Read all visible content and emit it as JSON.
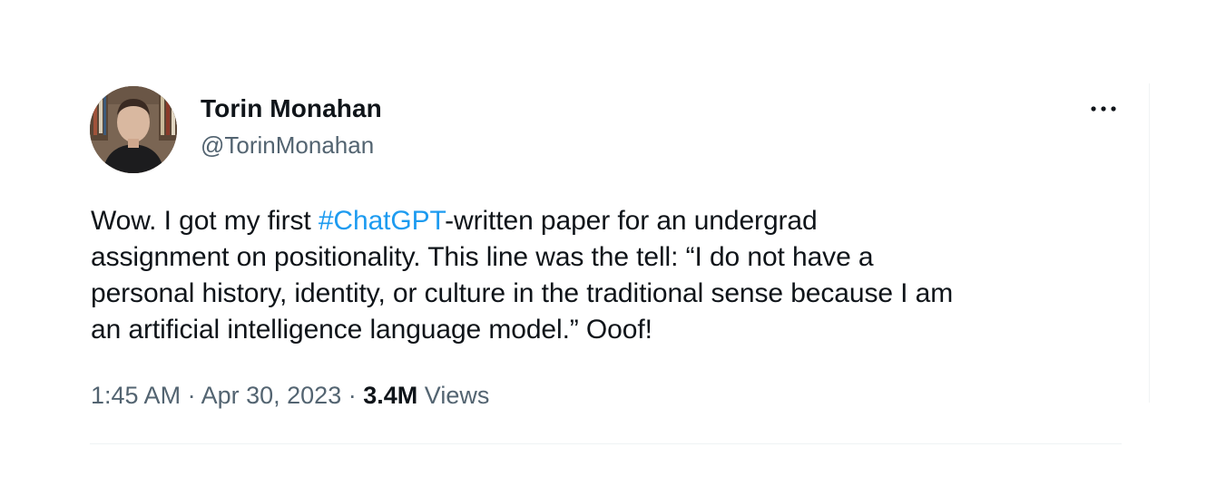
{
  "author": {
    "name": "Torin Monahan",
    "handle": "@TorinMonahan"
  },
  "more_icon": "more-horizontal-icon",
  "tweet": {
    "lines": [
      {
        "before": "Wow. I got my first ",
        "hashtag": "#ChatGPT",
        "after": "-written paper for an undergrad"
      },
      {
        "text": "assignment on positionality. This line was the tell: “I do not have a"
      },
      {
        "text": "personal history, identity, or culture in the traditional sense because I am"
      },
      {
        "text": "an artificial intelligence language model.” Ooof!"
      }
    ]
  },
  "meta": {
    "time": "1:45 AM",
    "separator": "·",
    "date": "Apr 30, 2023",
    "views_count": "3.4M",
    "views_label": "Views"
  },
  "colors": {
    "link": "#1d9bf0",
    "secondary_text": "#536471",
    "primary_text": "#0f1419"
  }
}
